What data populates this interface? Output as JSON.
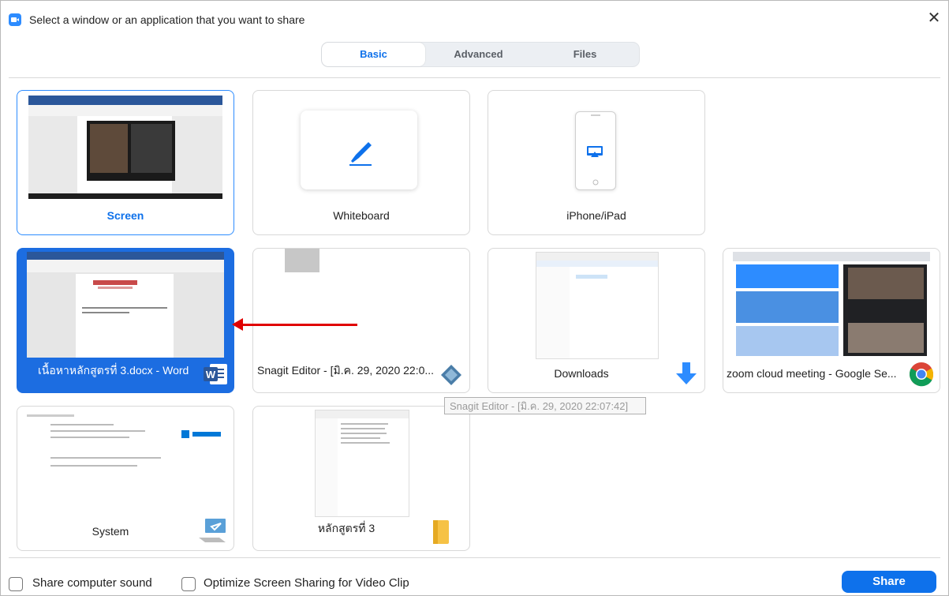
{
  "window": {
    "title": "Select a window or an application that you want to share",
    "close_glyph": "✕"
  },
  "tabs": [
    {
      "label": "Basic",
      "active": true
    },
    {
      "label": "Advanced",
      "active": false
    },
    {
      "label": "Files",
      "active": false
    }
  ],
  "tiles": {
    "screen": {
      "label": "Screen"
    },
    "whiteboard": {
      "label": "Whiteboard"
    },
    "iphone": {
      "label": "iPhone/iPad"
    },
    "word": {
      "label": "เนื้อหาหลักสูตรที่ 3.docx - Word",
      "badge": "W"
    },
    "snagit": {
      "label": "Snagit Editor - [มิ.ค. 29, 2020 22:0..."
    },
    "downloads": {
      "label": "Downloads"
    },
    "chrome": {
      "label": "zoom cloud meeting - Google Se..."
    },
    "system": {
      "label": "System"
    },
    "folder": {
      "label": "หลักสูตรที่ 3"
    }
  },
  "tooltip": "Snagit Editor - [มิ.ค. 29, 2020 22:07:42]",
  "footer": {
    "share_sound_label": "Share computer sound",
    "optimize_label": "Optimize Screen Sharing for Video Clip",
    "share_button": "Share"
  },
  "colors": {
    "accent": "#0e71eb",
    "selected_fill": "#1c6de1",
    "annotation_arrow": "#e00000"
  }
}
